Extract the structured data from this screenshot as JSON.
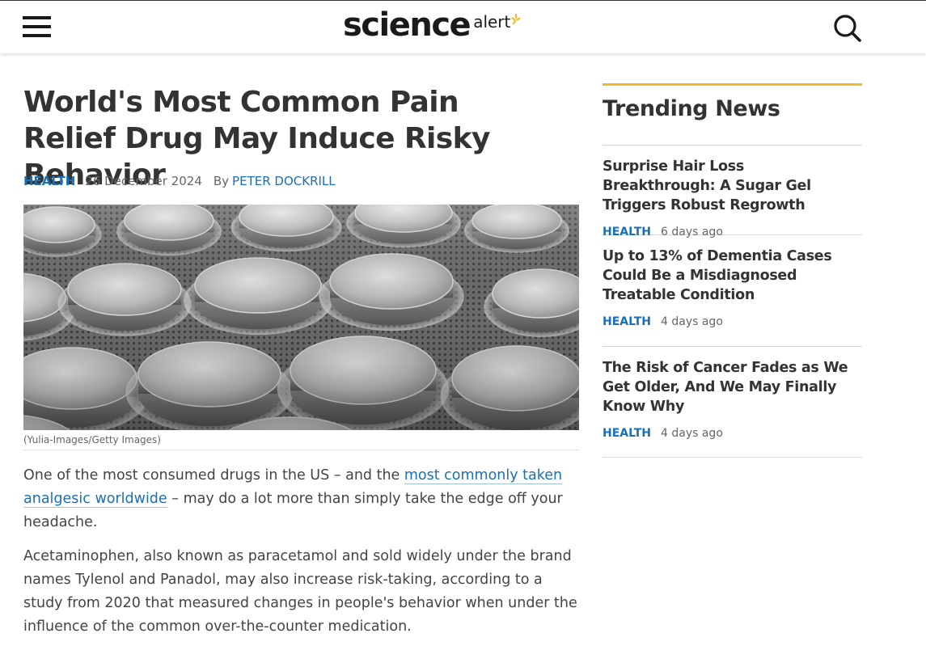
{
  "header": {
    "logo_main": "science",
    "logo_sub": "alert",
    "icons": {
      "menu": "menu-icon",
      "search": "search-icon",
      "logo_mark": "sunburst-icon"
    },
    "accent_color": "#f0b826",
    "link_color": "#1a6fb5"
  },
  "article": {
    "title": "World's Most Common Pain Relief Drug May Induce Risky Behavior",
    "category": "HEALTH",
    "date": "26 December 2024",
    "by_label": "By",
    "author": "PETER DOCKRILL",
    "image_caption": "(Yulia-Images/Getty Images)",
    "p1_before": "One of the most consumed drugs in the US – and the ",
    "p1_link": "most commonly taken analgesic worldwide",
    "p1_after": " – may do a lot more than simply take the edge off your headache.",
    "p2": "Acetaminophen, also known as paracetamol and sold widely under the brand names Tylenol and Panadol, may also increase risk-taking, according to a study from 2020 that measured changes in people's behavior when under the influence of the common over-the-counter medication."
  },
  "sidebar": {
    "title": "Trending News",
    "items": [
      {
        "title": "Surprise Hair Loss Breakthrough: A Sugar Gel Triggers Robust Regrowth",
        "category": "HEALTH",
        "ago": "6 days ago"
      },
      {
        "title": "Up to 13% of Dementia Cases Could Be a Misdiagnosed Treatable Condition",
        "category": "HEALTH",
        "ago": "4 days ago"
      },
      {
        "title": "The Risk of Cancer Fades as We Get Older, And We May Finally Know Why",
        "category": "HEALTH",
        "ago": "4 days ago"
      }
    ]
  }
}
